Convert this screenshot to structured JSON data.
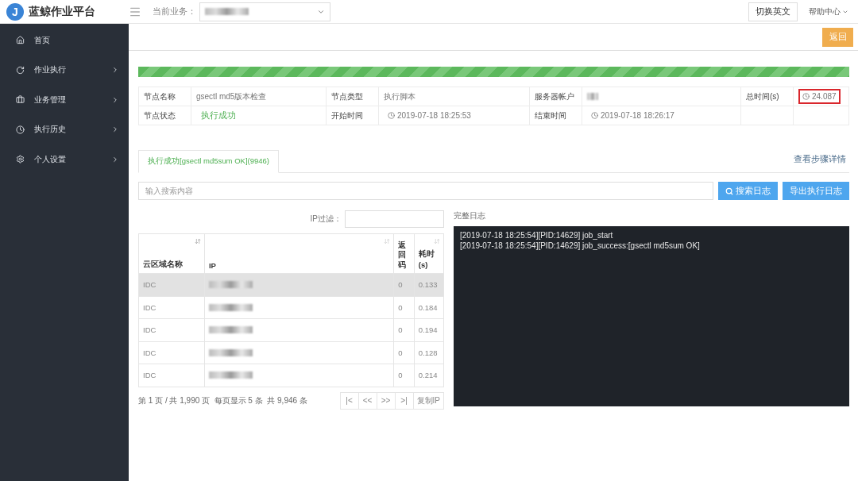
{
  "header": {
    "logo_letter": "J",
    "title": "蓝鲸作业平台",
    "business_label": "当前业务：",
    "language_button": "切换英文",
    "help": "帮助中心"
  },
  "sidebar": {
    "items": [
      {
        "label": "首页",
        "submenu": false
      },
      {
        "label": "作业执行",
        "submenu": true
      },
      {
        "label": "业务管理",
        "submenu": true
      },
      {
        "label": "执行历史",
        "submenu": true
      },
      {
        "label": "个人设置",
        "submenu": true
      }
    ]
  },
  "toolbar": {
    "back_button": "返回"
  },
  "progress": {
    "level": 1
  },
  "node_info": {
    "rows": [
      [
        {
          "label": "节点名称",
          "value": "gsectl md5版本检查",
          "kind": "text"
        },
        {
          "label": "节点类型",
          "value": "执行脚本",
          "kind": "text"
        },
        {
          "label": "服务器帐户",
          "kind": "masked"
        },
        {
          "label": "总时间(s)",
          "value": "24.087",
          "kind": "time",
          "highlighted": true
        }
      ],
      [
        {
          "label": "节点状态",
          "value": "执行成功",
          "kind": "status"
        },
        {
          "label": "开始时间",
          "value": "2019-07-18 18:25:53",
          "kind": "time"
        },
        {
          "label": "结束时间",
          "value": "2019-07-18 18:26:17",
          "kind": "time"
        },
        {
          "kind": "empty"
        }
      ]
    ]
  },
  "tabs": [
    {
      "label": "执行成功[gsectl md5sum OK](9946)",
      "selected": true
    }
  ],
  "step_details_link": "查看步骤详情",
  "search": {
    "placeholder": "输入搜索内容",
    "buttons": [
      {
        "label": "搜索日志",
        "kind": "search"
      },
      {
        "label": "导出执行日志",
        "kind": "plain"
      }
    ]
  },
  "ip_filter": {
    "label": "IP过滤："
  },
  "hosts_table": {
    "columns": [
      {
        "label": "云区域名称",
        "sortable": true
      },
      {
        "label": "IP",
        "sortable": true
      },
      {
        "label": "返回码",
        "sortable": false
      },
      {
        "label": "耗时(s)",
        "sortable": true
      }
    ],
    "rows": [
      {
        "cloud_area": "IDC",
        "return_code": "0",
        "duration": "0.133",
        "selected": true
      },
      {
        "cloud_area": "IDC",
        "return_code": "0",
        "duration": "0.184",
        "selected": false
      },
      {
        "cloud_area": "IDC",
        "return_code": "0",
        "duration": "0.194",
        "selected": false
      },
      {
        "cloud_area": "IDC",
        "return_code": "0",
        "duration": "0.128",
        "selected": false
      },
      {
        "cloud_area": "IDC",
        "return_code": "0",
        "duration": "0.214",
        "selected": false
      }
    ]
  },
  "pagination": {
    "summary": "第 1 页 / 共 1,990 页  每页显示 5 条  共 9,946 条",
    "buttons": [
      "|<",
      "<<",
      ">>",
      ">|",
      "复制IP"
    ]
  },
  "log": {
    "title": "完整日志",
    "lines": [
      "[2019-07-18 18:25:54][PID:14629] job_start",
      "[2019-07-18 18:25:54][PID:14629] job_success:[gsectl md5sum OK]"
    ]
  }
}
